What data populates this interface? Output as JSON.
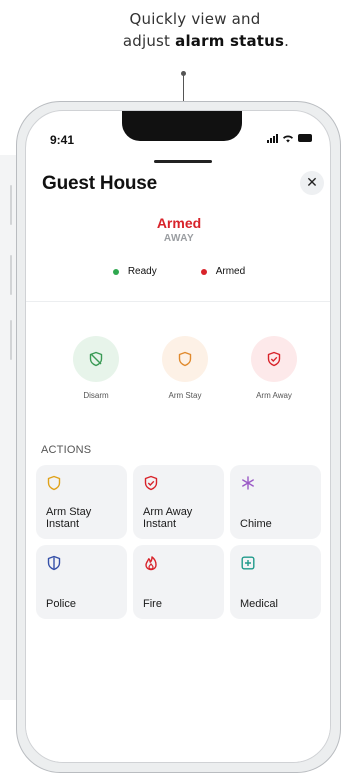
{
  "caption": {
    "line1": "Quickly view and",
    "line2_prefix": "adjust",
    "line2_bold": "alarm status",
    "line2_suffix": "."
  },
  "status_bar": {
    "time": "9:41"
  },
  "sheet": {
    "title": "Guest House",
    "close_glyph": "✕",
    "alarm_state": "Armed",
    "alarm_mode": "AWAY",
    "legend": [
      {
        "label": "Ready",
        "color": "#2fa84f"
      },
      {
        "label": "Armed",
        "color": "#d8232a"
      }
    ],
    "modes": [
      {
        "label": "Disarm",
        "icon": "shield-slash-icon",
        "bg": "#e7f4ea",
        "fg": "#3a9a55"
      },
      {
        "label": "Arm Stay",
        "icon": "shield-icon",
        "bg": "#fdf1e6",
        "fg": "#e08a2e"
      },
      {
        "label": "Arm Away",
        "icon": "shield-check-icon",
        "bg": "#fde9ea",
        "fg": "#d8232a"
      }
    ],
    "actions_heading": "ACTIONS",
    "actions": [
      {
        "label_line1": "Arm Stay",
        "label_line2": "Instant",
        "icon": "shield-icon",
        "color": "#e0a21a"
      },
      {
        "label_line1": "Arm Away",
        "label_line2": "Instant",
        "icon": "shield-check-icon",
        "color": "#d8232a"
      },
      {
        "label_line1": "",
        "label_line2": "Chime",
        "icon": "chime-icon",
        "color": "#9b59c6"
      },
      {
        "label_line1": "",
        "label_line2": "Police",
        "icon": "police-shield-icon",
        "color": "#3550a8"
      },
      {
        "label_line1": "",
        "label_line2": "Fire",
        "icon": "fire-icon",
        "color": "#d8232a"
      },
      {
        "label_line1": "",
        "label_line2": "Medical",
        "icon": "medical-plus-icon",
        "color": "#1f9a8a"
      }
    ]
  }
}
